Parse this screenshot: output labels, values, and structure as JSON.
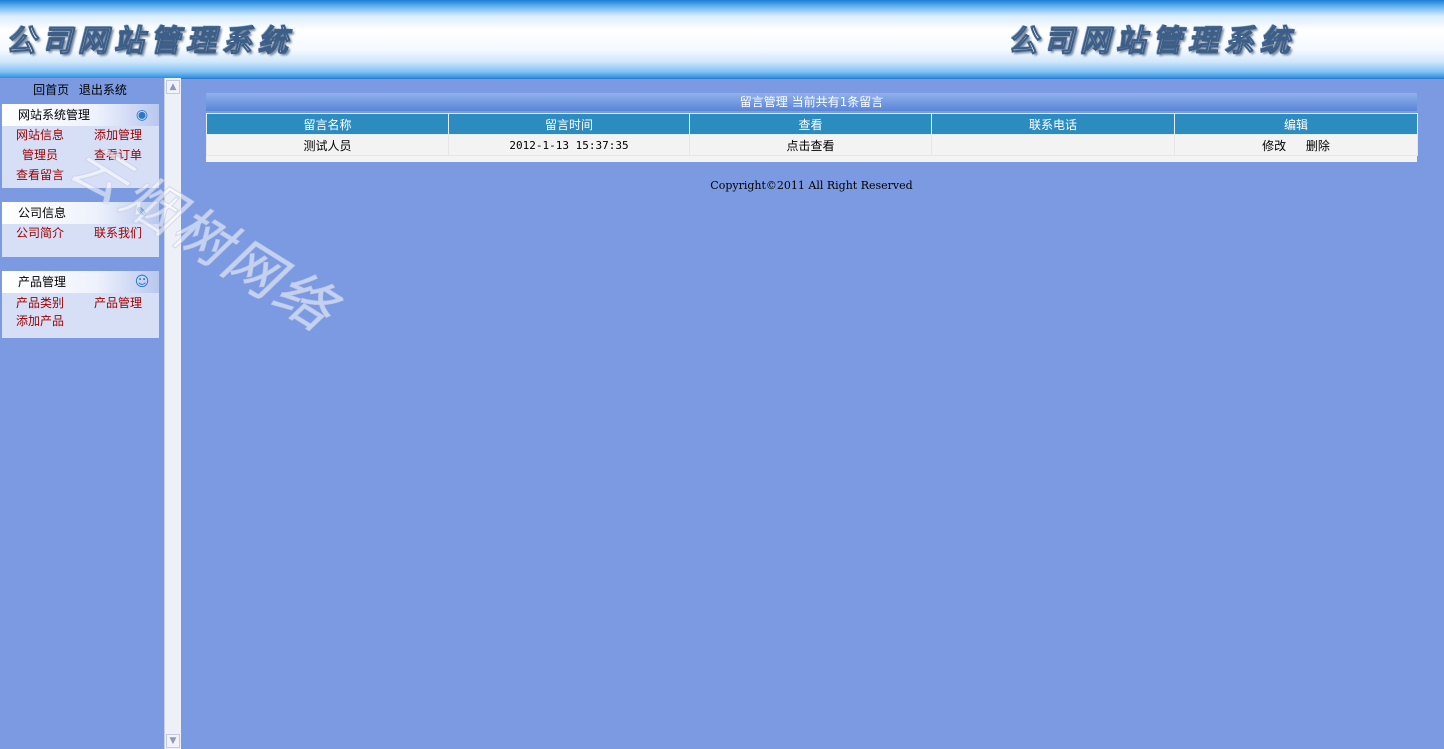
{
  "header": {
    "banner_left": "公司网站管理系统",
    "banner_right": "公司网站管理系统"
  },
  "sidebar": {
    "top_links": [
      "回首页",
      "退出系统"
    ],
    "panels": [
      {
        "title": "网站系统管理",
        "icon": "globe-icon",
        "links": [
          "网站信息",
          "添加管理",
          "管理员",
          "查看订单",
          "查看留言"
        ]
      },
      {
        "title": "公司信息",
        "icon": "edit-note-icon",
        "links": [
          "公司简介",
          "联系我们"
        ]
      },
      {
        "title": "产品管理",
        "icon": "user-icon",
        "links": [
          "产品类别",
          "产品管理",
          "添加产品"
        ]
      }
    ]
  },
  "scrollbar": {
    "up_glyph": "▲",
    "down_glyph": "▼"
  },
  "main": {
    "table_title": "留言管理 当前共有1条留言",
    "columns": [
      "留言名称",
      "留言时间",
      "查看",
      "联系电话",
      "编辑"
    ],
    "rows": [
      {
        "name": "测试人员",
        "time": "2012-1-13 15:37:35",
        "view": "点击查看",
        "phone": "",
        "edit": "修改",
        "delete": "删除"
      }
    ],
    "copyright": "Copyright©2011 All Right Reserved"
  },
  "watermark": "云烟树网络",
  "colors": {
    "background": "#7b9ae2",
    "table_header": "#2c8cbf",
    "link": "#990000"
  }
}
